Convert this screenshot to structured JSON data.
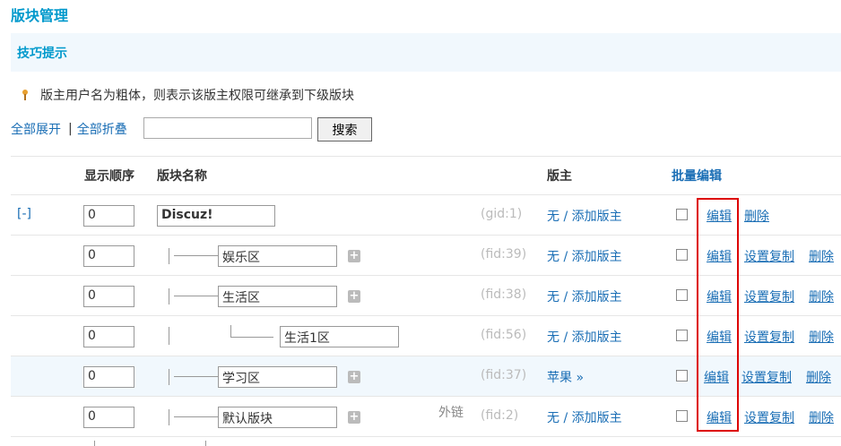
{
  "page": {
    "title": "版块管理"
  },
  "tips": {
    "title": "技巧提示",
    "text": "版主用户名为粗体，则表示该版主权限可继承到下级版块"
  },
  "tools": {
    "expand_all": "全部展开",
    "separator": "|",
    "collapse_all": "全部折叠",
    "search_value": "",
    "search_button": "搜索"
  },
  "table": {
    "headers": {
      "order": "显示顺序",
      "name": "版块名称",
      "moderator": "版主",
      "batch_edit": "批量编辑"
    },
    "rows": [
      {
        "toggle": "[-]",
        "order": "0",
        "name": "Discuz!",
        "id": "(gid:1)",
        "mod_none": "无",
        "mod_sep": "/",
        "mod_add": "添加版主",
        "edit": "编辑",
        "delete": "删除"
      },
      {
        "order": "0",
        "name": "娱乐区",
        "id": "(fid:39)",
        "mod_none": "无",
        "mod_sep": "/",
        "mod_add": "添加版主",
        "edit": "编辑",
        "copy": "设置复制",
        "delete": "删除"
      },
      {
        "order": "0",
        "name": "生活区",
        "id": "(fid:38)",
        "mod_none": "无",
        "mod_sep": "/",
        "mod_add": "添加版主",
        "edit": "编辑",
        "copy": "设置复制",
        "delete": "删除"
      },
      {
        "order": "0",
        "name": "生活1区",
        "id": "(fid:56)",
        "mod_none": "无",
        "mod_sep": "/",
        "mod_add": "添加版主",
        "edit": "编辑",
        "copy": "设置复制",
        "delete": "删除"
      },
      {
        "order": "0",
        "name": "学习区",
        "id": "(fid:37)",
        "mod_name": "苹果",
        "mod_more": "»",
        "edit": "编辑",
        "copy": "设置复制",
        "delete": "删除"
      },
      {
        "order": "0",
        "name": "默认版块",
        "external": "外链",
        "id": "(fid:2)",
        "mod_none": "无",
        "mod_sep": "/",
        "mod_add": "添加版主",
        "edit": "编辑",
        "copy": "设置复制",
        "delete": "删除"
      }
    ]
  },
  "icons": {
    "tip": "lightbulb-icon",
    "add": "plus-icon"
  },
  "colors": {
    "accent": "#0099cc",
    "link": "#1a6eb5",
    "highlight": "#dd0000",
    "tip_bg": "#f1f8fd"
  }
}
